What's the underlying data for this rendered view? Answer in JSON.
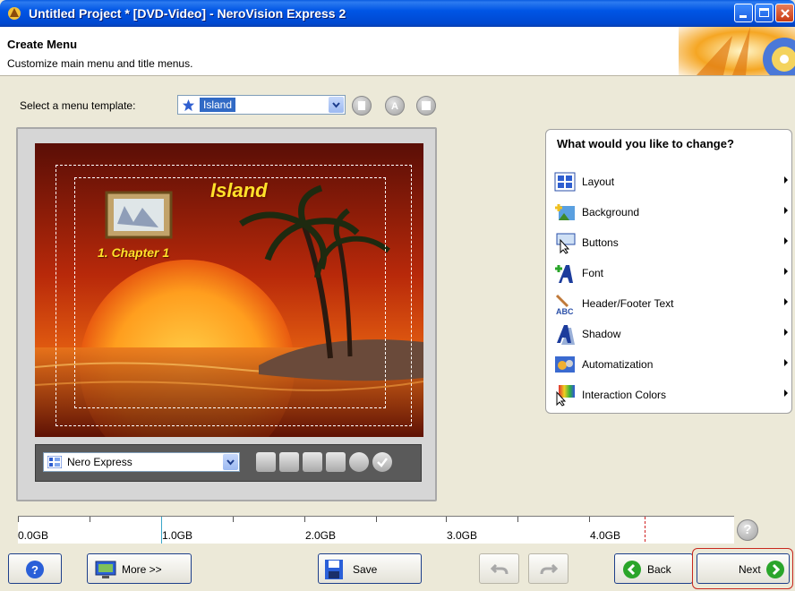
{
  "window": {
    "title": "Untitled Project * [DVD-Video] - NeroVision Express 2"
  },
  "header": {
    "title": "Create Menu",
    "subtitle": "Customize main menu and title menus."
  },
  "template": {
    "label": "Select a menu template:",
    "selected": "Island"
  },
  "preview": {
    "menu_title": "Island",
    "chapter_label": "1. Chapter 1",
    "style_selected": "Nero Express"
  },
  "change_panel": {
    "heading": "What would you like to change?",
    "items": [
      {
        "label": "Layout",
        "icon": "layout-icon"
      },
      {
        "label": "Background",
        "icon": "background-icon"
      },
      {
        "label": "Buttons",
        "icon": "buttons-icon"
      },
      {
        "label": "Font",
        "icon": "font-icon"
      },
      {
        "label": "Header/Footer Text",
        "icon": "header-footer-icon"
      },
      {
        "label": "Shadow",
        "icon": "shadow-icon"
      },
      {
        "label": "Automatization",
        "icon": "automatization-icon"
      },
      {
        "label": "Interaction Colors",
        "icon": "interaction-colors-icon"
      }
    ]
  },
  "capacity": {
    "labels": [
      "0.0GB",
      "1.0GB",
      "2.0GB",
      "3.0GB",
      "4.0GB"
    ]
  },
  "buttons": {
    "more": "More >>",
    "save": "Save",
    "back": "Back",
    "next": "Next"
  },
  "colors": {
    "titlebar": "#0055e5",
    "accent": "#316ac5",
    "next_highlight": "#c8281e"
  }
}
